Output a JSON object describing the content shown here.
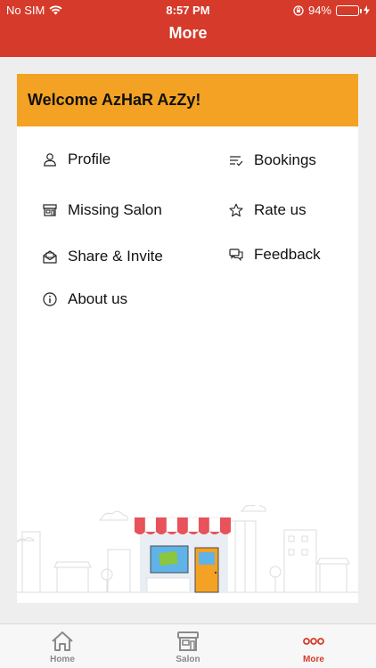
{
  "status_bar": {
    "carrier": "No SIM",
    "time": "8:57 PM",
    "battery": "94%",
    "battery_level": 0.94
  },
  "header": {
    "title": "More"
  },
  "welcome": {
    "text": "Welcome AzHaR AzZy!"
  },
  "menu": {
    "profile": "Profile",
    "bookings": "Bookings",
    "missing_salon": "Missing Salon",
    "rate_us": "Rate us",
    "share_invite": "Share & Invite",
    "feedback": "Feedback",
    "about_us": "About us"
  },
  "tabs": [
    {
      "label": "Home",
      "icon": "home-icon"
    },
    {
      "label": "Salon",
      "icon": "store-icon"
    },
    {
      "label": "More",
      "icon": "more-icon",
      "active": true
    }
  ],
  "colors": {
    "header": "#d63a2a",
    "welcome_bg": "#f4a223",
    "active_tab": "#d63a2a"
  }
}
